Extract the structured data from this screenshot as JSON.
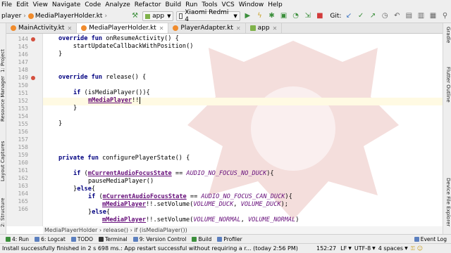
{
  "menu": [
    "File",
    "Edit",
    "View",
    "Navigate",
    "Code",
    "Analyze",
    "Refactor",
    "Build",
    "Run",
    "Tools",
    "VCS",
    "Window",
    "Help"
  ],
  "toolbar": {
    "breadcrumb": [
      "player",
      "MediaPlayerHolder.kt"
    ],
    "run_config": "app",
    "device": "Xiaomi Redmi 4",
    "git_label": "Git:"
  },
  "tabs": [
    {
      "label": "MainActivity.kt",
      "color": "#f08b2c",
      "active": false
    },
    {
      "label": "MediaPlayerHolder.kt",
      "color": "#f08b2c",
      "active": true
    },
    {
      "label": "PlayerAdapter.kt",
      "color": "#f08b2c",
      "active": false
    },
    {
      "label": "app",
      "color": "#7fb24a",
      "active": false
    }
  ],
  "left_tools": [
    "1: Project",
    "Resource Manager",
    "Layout Captures",
    "2: Structure"
  ],
  "right_tools": [
    "Gradle",
    "Flutter Outline",
    "Device File Explorer"
  ],
  "line_numbers": [
    "144",
    "145",
    "146",
    "147",
    "148",
    "149",
    "150",
    "151",
    "152",
    "153",
    "154",
    "155",
    "156",
    "157",
    "158",
    "159",
    "160",
    "161",
    "162",
    "163",
    "164",
    "165",
    "166"
  ],
  "code_lines": {
    "l144": {
      "kw": "override fun ",
      "rest": "onResumeActivity() {"
    },
    "l145": {
      "text": "    startUpdateCallbackWithPosition()"
    },
    "l146": {
      "text": "}"
    },
    "l149": {
      "kw": "override fun ",
      "rest": "release() {"
    },
    "l151": {
      "kw": "if ",
      "rest": "(isMediaPlayer()){"
    },
    "l152": {
      "field": "mMediaPlayer",
      "rest": "!!"
    },
    "l153": {
      "text": "}"
    },
    "l155": {
      "text": "}"
    },
    "l158": {
      "kw": "private fun ",
      "rest": "configurePlayerState() {"
    },
    "l160": {
      "kw": "if ",
      "paren": "(",
      "field": "mCurrentAudioFocusState",
      "op": " == ",
      "const": "AUDIO_NO_FOCUS_NO_DUCK",
      "rest": "){"
    },
    "l161": {
      "text": "pauseMediaPlayer()"
    },
    "l162": {
      "pre": "}",
      "kw": "else",
      "rest": "{"
    },
    "l163": {
      "kw": "if ",
      "paren": "(",
      "field": "mCurrentAudioFocusState",
      "op": " == ",
      "const": "AUDIO_NO_FOCUS_CAN_DUCK",
      "rest": "){"
    },
    "l164": {
      "field": "mMediaPlayer",
      "mid": "!!.setVolume(",
      "const": "VOLUME_DUCK",
      "sep": ", ",
      "const2": "VOLUME_DUCK",
      "rest": ");"
    },
    "l165": {
      "pre": "}",
      "kw": "else",
      "rest": "{"
    },
    "l166": {
      "field": "mMediaPlayer",
      "mid": "!!.setVolume(",
      "const": "VOLUME_NORMAL",
      "sep": ", ",
      "const2": "VOLUME_NORMAL",
      "rest": ")"
    }
  },
  "editor_breadcrumb": "MediaPlayerHolder  ›  release()  ›  if (isMediaPlayer())",
  "bottom_tools": [
    {
      "label": "4: Run",
      "color": "#3c8f3c"
    },
    {
      "label": "6: Logcat",
      "color": "#5b7fbf"
    },
    {
      "label": "TODO",
      "color": "#5b7fbf"
    },
    {
      "label": "Terminal",
      "color": "#333333"
    },
    {
      "label": "9: Version Control",
      "color": "#5b7fbf"
    },
    {
      "label": "Build",
      "color": "#3c8f3c"
    },
    {
      "label": "Profiler",
      "color": "#5b7fbf"
    },
    {
      "label": "Event Log",
      "color": "#5b7fbf"
    }
  ],
  "status": {
    "message": "Install successfully finished in 2 s 698 ms.: App restart successful without requiring a r... (today 2:56 PM)",
    "position": "152:27",
    "line_sep": "LF",
    "encoding": "UTF-8",
    "indent": "4 spaces"
  },
  "colors": {
    "keyword": "#000080",
    "field": "#660e7a",
    "current_line": "#fffae3"
  }
}
